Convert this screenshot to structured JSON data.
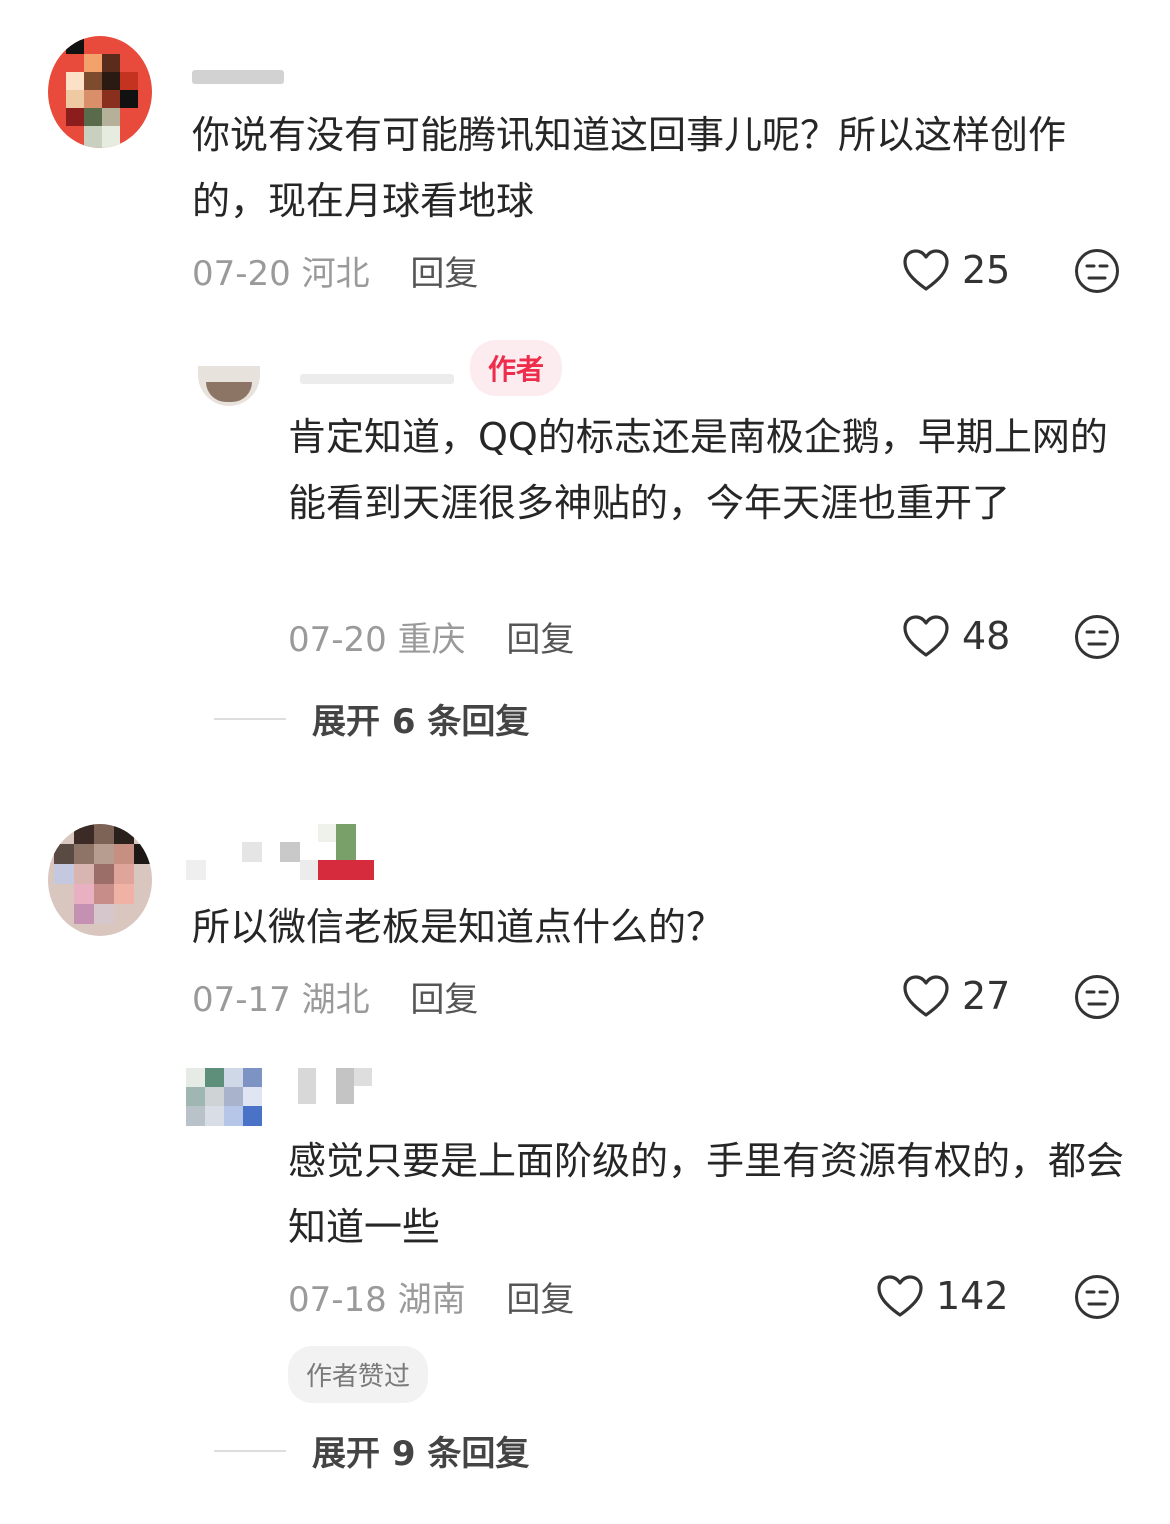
{
  "comments": [
    {
      "text": "你说有没有可能腾讯知道这回事儿呢？所以这样创作的，现在月球看地球",
      "date": "07-20",
      "location": "河北",
      "reply_label": "回复",
      "likes": "25",
      "replies": [
        {
          "badge": "作者",
          "text": "肯定知道，QQ的标志还是南极企鹅，早期上网的能看到天涯很多神贴的，今年天涯也重开了",
          "date": "07-20",
          "location": "重庆",
          "reply_label": "回复",
          "likes": "48"
        }
      ],
      "expand_label": "展开 6 条回复"
    },
    {
      "text": "所以微信老板是知道点什么的？",
      "date": "07-17",
      "location": "湖北",
      "reply_label": "回复",
      "likes": "27",
      "replies": [
        {
          "text": "感觉只要是上面阶级的，手里有资源有权的，都会知道一些",
          "date": "07-18",
          "location": "湖南",
          "reply_label": "回复",
          "likes": "142",
          "author_liked": "作者赞过"
        }
      ],
      "expand_label": "展开 9 条回复"
    }
  ],
  "icons": {
    "heart": "heart-icon",
    "reaction": "neutral-face-icon"
  },
  "colors": {
    "author_badge_text": "#ee2c4b",
    "author_badge_bg": "#fdecef",
    "meta_gray": "#9a9a9a"
  }
}
